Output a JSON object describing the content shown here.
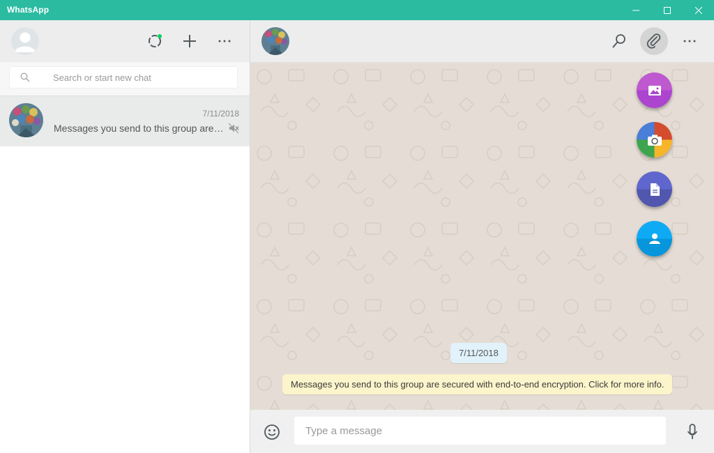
{
  "window": {
    "title": "WhatsApp"
  },
  "left_panel": {
    "search": {
      "placeholder": "Search or start new chat"
    },
    "chats": [
      {
        "date": "7/11/2018",
        "preview": "Messages you send to this group are secured with end-to-end encryption. Click for more info.",
        "muted": true
      }
    ]
  },
  "conversation": {
    "date_chip": "7/11/2018",
    "system_notice": "Messages you send to this group are secured with end-to-end encryption. Click for more info.",
    "input_placeholder": "Type a message"
  },
  "colors": {
    "brand": "#2bbba1",
    "gallery": "#ac44cf",
    "document": "#5157ae",
    "contact": "#0795dc",
    "status_dot": "#09d261"
  }
}
